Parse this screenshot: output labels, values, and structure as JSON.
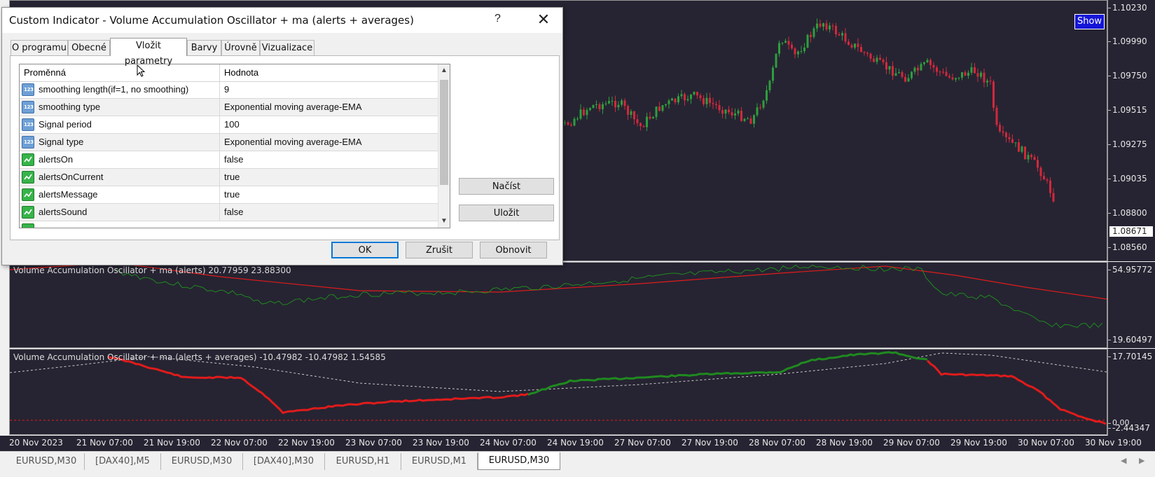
{
  "dialog": {
    "title": "Custom Indicator - Volume Accumulation Oscillator + ma (alerts + averages)",
    "help": "?",
    "close": "✕",
    "tabs": [
      "O programu",
      "Obecné",
      "Vložit parametry",
      "Barvy",
      "Úrovně",
      "Vizualizace"
    ],
    "active_tab": "Vložit parametry",
    "grid": {
      "header": {
        "variable": "Proměnná",
        "value": "Hodnota"
      },
      "rows": [
        {
          "name": "smoothing length(if=1, no smoothing)",
          "value": "9",
          "icon": "number-icon"
        },
        {
          "name": "smoothing type",
          "value": "Exponential moving average-EMA",
          "icon": "number-icon"
        },
        {
          "name": "Signal period",
          "value": "100",
          "icon": "number-icon"
        },
        {
          "name": "Signal type",
          "value": "Exponential moving average-EMA",
          "icon": "number-icon"
        },
        {
          "name": "alertsOn",
          "value": "false",
          "icon": "boolean-icon"
        },
        {
          "name": "alertsOnCurrent",
          "value": "true",
          "icon": "boolean-icon"
        },
        {
          "name": "alertsMessage",
          "value": "true",
          "icon": "boolean-icon"
        },
        {
          "name": "alertsSound",
          "value": "false",
          "icon": "boolean-icon"
        }
      ],
      "icon_text": "123"
    },
    "side_buttons": {
      "load": "Načíst",
      "save": "Uložit"
    },
    "footer_buttons": {
      "ok": "OK",
      "cancel": "Zrušit",
      "reset": "Obnovit"
    }
  },
  "chart": {
    "show_button": "Show",
    "main_price_labels": [
      "1.10230",
      "1.09990",
      "1.09750",
      "1.09515",
      "1.09275",
      "1.09035",
      "1.08800",
      "1.08560"
    ],
    "current_price": "1.08671",
    "osc1": {
      "title": "Volume Accumulation Oscillator + ma (alerts) 20.77959 23.88300",
      "scale_max": "54.95772",
      "scale_min": "19.60497"
    },
    "osc2": {
      "title": "Volume Accumulation Oscillator + ma (alerts + averages) -10.47982 -10.47982 1.54585",
      "scale_max": "17.70145",
      "zero_label": "0.00",
      "scale_min": "-2.44347"
    },
    "time_labels": [
      "20 Nov 2023",
      "21 Nov 07:00",
      "21 Nov 19:00",
      "22 Nov 07:00",
      "22 Nov 19:00",
      "23 Nov 07:00",
      "23 Nov 19:00",
      "24 Nov 07:00",
      "24 Nov 19:00",
      "27 Nov 07:00",
      "27 Nov 19:00",
      "28 Nov 07:00",
      "28 Nov 19:00",
      "29 Nov 07:00",
      "29 Nov 19:00",
      "30 Nov 07:00",
      "30 Nov 19:00"
    ],
    "colors": {
      "background": "#262432",
      "bull": "#2e9e3e",
      "bear": "#d2283c",
      "signal": "#e01b1b",
      "osc_line": "#1f8a1f"
    }
  },
  "tabs": [
    "EURUSD,M30",
    "[DAX40],M5",
    "EURUSD,M30",
    "[DAX40],M30",
    "EURUSD,H1",
    "EURUSD,M1",
    "EURUSD,M30"
  ],
  "active_symbol_tab": "EURUSD,M30",
  "tab_nav": {
    "left": "◀",
    "right": "▶"
  }
}
